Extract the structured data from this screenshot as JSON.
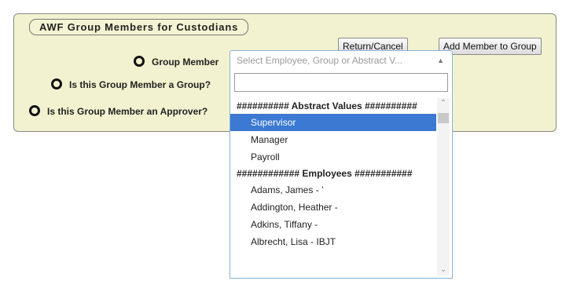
{
  "panel": {
    "title": "AWF Group Members for Custodians"
  },
  "buttons": {
    "return_cancel": "Return/Cancel",
    "add_member": "Add Member to Group"
  },
  "fields": [
    {
      "label": "Group Member"
    },
    {
      "label": "Is this Group Member a Group?"
    },
    {
      "label": "Is this Group Member an Approver?"
    }
  ],
  "select": {
    "placeholder": "Select Employee, Group or Abstract V...",
    "search_value": ""
  },
  "dropdown": {
    "items": [
      {
        "text": "########## Abstract Values ##########",
        "type": "group"
      },
      {
        "text": "Supervisor",
        "type": "option",
        "selected": true
      },
      {
        "text": "Manager",
        "type": "option"
      },
      {
        "text": "Payroll",
        "type": "option"
      },
      {
        "text": "############ Employees ###########",
        "type": "group"
      },
      {
        "text": "Adams, James - ’",
        "type": "option"
      },
      {
        "text": "Addington, Heather -",
        "type": "option"
      },
      {
        "text": "Adkins, Tiffany -",
        "type": "option"
      },
      {
        "text": "Albrecht, Lisa - IBJT",
        "type": "option"
      }
    ]
  },
  "colors": {
    "panel_bg": "#f2f2d0",
    "highlight": "#3b79d2",
    "border_focus": "#8ab1d9"
  },
  "icons": {
    "search": "magnifier-icon",
    "radio": "ring-icon"
  }
}
